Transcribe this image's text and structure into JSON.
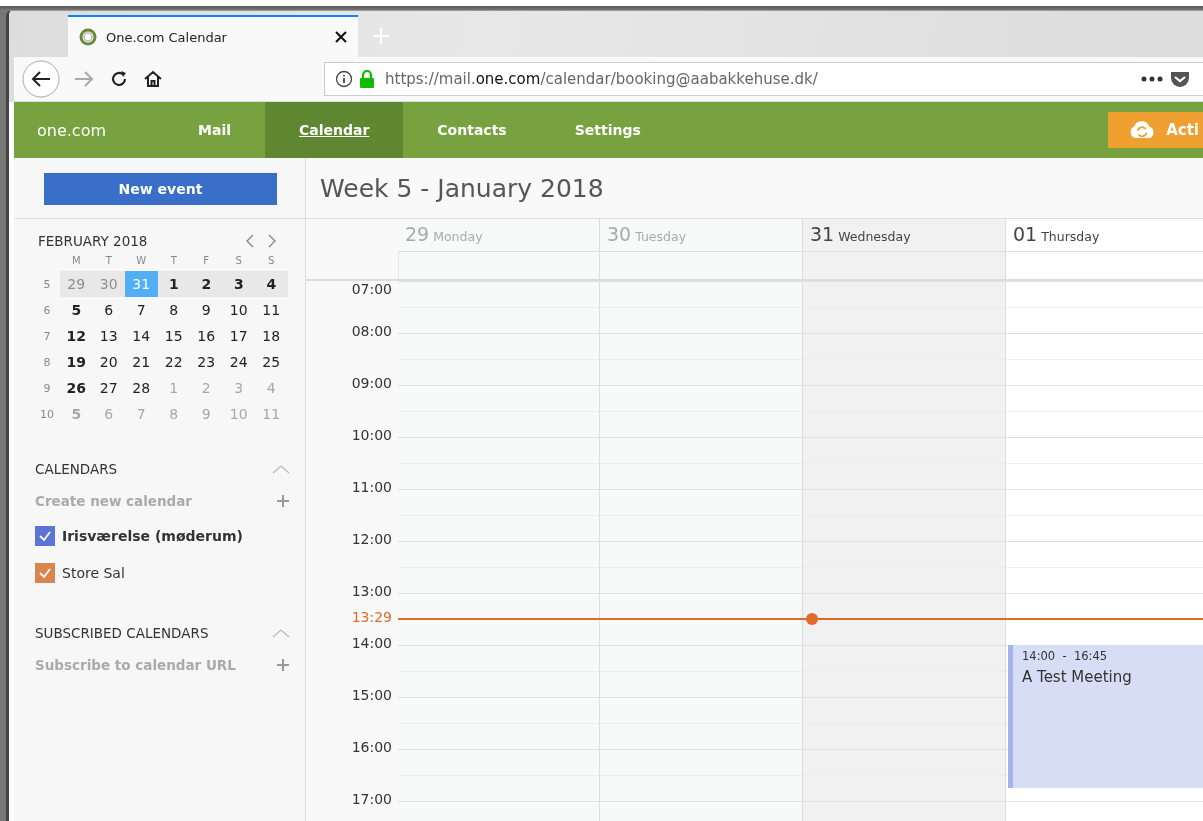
{
  "browser": {
    "tab_title": "One.com Calendar",
    "url": [
      {
        "text": "https://mail.",
        "emphasis": false
      },
      {
        "text": "one.com",
        "emphasis": true
      },
      {
        "text": "/calendar/booking@aabakkehuse.dk/",
        "emphasis": false
      }
    ],
    "forward_disabled": true
  },
  "app_bar": {
    "logo": "one.com",
    "items": [
      {
        "label": "Mail",
        "selected": false
      },
      {
        "label": "Calendar",
        "selected": true
      },
      {
        "label": "Contacts",
        "selected": false
      },
      {
        "label": "Settings",
        "selected": false
      }
    ],
    "action_button": "Acti"
  },
  "sidebar": {
    "new_event_button": "New event",
    "mini_calendar": {
      "title": "FEBRUARY 2018",
      "weekdays": [
        "M",
        "T",
        "W",
        "T",
        "F",
        "S",
        "S"
      ],
      "weeks": [
        {
          "number": "5",
          "current": true,
          "days": [
            {
              "label": "29",
              "kind": "other",
              "bold": false,
              "selected": false
            },
            {
              "label": "30",
              "kind": "other",
              "bold": false,
              "selected": false
            },
            {
              "label": "31",
              "kind": "month",
              "bold": false,
              "selected": true
            },
            {
              "label": "1",
              "kind": "month",
              "bold": true,
              "selected": false
            },
            {
              "label": "2",
              "kind": "month",
              "bold": true,
              "selected": false
            },
            {
              "label": "3",
              "kind": "month",
              "bold": true,
              "selected": false
            },
            {
              "label": "4",
              "kind": "month",
              "bold": true,
              "selected": false
            }
          ]
        },
        {
          "number": "6",
          "current": false,
          "days": [
            {
              "label": "5",
              "kind": "month",
              "bold": true,
              "selected": false
            },
            {
              "label": "6",
              "kind": "month",
              "bold": false,
              "selected": false
            },
            {
              "label": "7",
              "kind": "month",
              "bold": false,
              "selected": false
            },
            {
              "label": "8",
              "kind": "month",
              "bold": false,
              "selected": false
            },
            {
              "label": "9",
              "kind": "month",
              "bold": false,
              "selected": false
            },
            {
              "label": "10",
              "kind": "month",
              "bold": false,
              "selected": false
            },
            {
              "label": "11",
              "kind": "month",
              "bold": false,
              "selected": false
            }
          ]
        },
        {
          "number": "7",
          "current": false,
          "days": [
            {
              "label": "12",
              "kind": "month",
              "bold": true,
              "selected": false
            },
            {
              "label": "13",
              "kind": "month",
              "bold": false,
              "selected": false
            },
            {
              "label": "14",
              "kind": "month",
              "bold": false,
              "selected": false
            },
            {
              "label": "15",
              "kind": "month",
              "bold": false,
              "selected": false
            },
            {
              "label": "16",
              "kind": "month",
              "bold": false,
              "selected": false
            },
            {
              "label": "17",
              "kind": "month",
              "bold": false,
              "selected": false
            },
            {
              "label": "18",
              "kind": "month",
              "bold": false,
              "selected": false
            }
          ]
        },
        {
          "number": "8",
          "current": false,
          "days": [
            {
              "label": "19",
              "kind": "month",
              "bold": true,
              "selected": false
            },
            {
              "label": "20",
              "kind": "month",
              "bold": false,
              "selected": false
            },
            {
              "label": "21",
              "kind": "month",
              "bold": false,
              "selected": false
            },
            {
              "label": "22",
              "kind": "month",
              "bold": false,
              "selected": false
            },
            {
              "label": "23",
              "kind": "month",
              "bold": false,
              "selected": false
            },
            {
              "label": "24",
              "kind": "month",
              "bold": false,
              "selected": false
            },
            {
              "label": "25",
              "kind": "month",
              "bold": false,
              "selected": false
            }
          ]
        },
        {
          "number": "9",
          "current": false,
          "days": [
            {
              "label": "26",
              "kind": "month",
              "bold": true,
              "selected": false
            },
            {
              "label": "27",
              "kind": "month",
              "bold": false,
              "selected": false
            },
            {
              "label": "28",
              "kind": "month",
              "bold": false,
              "selected": false
            },
            {
              "label": "1",
              "kind": "other",
              "bold": false,
              "selected": false
            },
            {
              "label": "2",
              "kind": "other",
              "bold": false,
              "selected": false
            },
            {
              "label": "3",
              "kind": "other",
              "bold": false,
              "selected": false
            },
            {
              "label": "4",
              "kind": "other",
              "bold": false,
              "selected": false
            }
          ]
        },
        {
          "number": "10",
          "current": false,
          "days": [
            {
              "label": "5",
              "kind": "other",
              "bold": true,
              "selected": false
            },
            {
              "label": "6",
              "kind": "other",
              "bold": false,
              "selected": false
            },
            {
              "label": "7",
              "kind": "other",
              "bold": false,
              "selected": false
            },
            {
              "label": "8",
              "kind": "other",
              "bold": false,
              "selected": false
            },
            {
              "label": "9",
              "kind": "other",
              "bold": false,
              "selected": false
            },
            {
              "label": "10",
              "kind": "other",
              "bold": false,
              "selected": false
            },
            {
              "label": "11",
              "kind": "other",
              "bold": false,
              "selected": false
            }
          ]
        }
      ]
    },
    "sections": [
      {
        "title": "CALENDARS",
        "expanded": true,
        "action": "Create new calendar",
        "calendars": [
          {
            "name": "Irisværelse (møderum)",
            "checked": true,
            "color": "#5b74d6",
            "emphasized": true
          },
          {
            "name": "Store Sal",
            "checked": true,
            "color": "#d9864e",
            "emphasized": false
          }
        ]
      },
      {
        "title": "SUBSCRIBED CALENDARS",
        "expanded": true,
        "action": "Subscribe to calendar URL"
      }
    ]
  },
  "week": {
    "title": "Week 5 - January 2018",
    "days": [
      {
        "number": "29",
        "name": "Monday",
        "kind": "past"
      },
      {
        "number": "30",
        "name": "Tuesday",
        "kind": "past"
      },
      {
        "number": "31",
        "name": "Wednesday",
        "kind": "today"
      },
      {
        "number": "01",
        "name": "Thursday",
        "kind": "future",
        "events": [
          {
            "time": "14:00  -  16:45",
            "title": "A Test Meeting",
            "color": "#d6ddf5"
          }
        ]
      }
    ],
    "hours": [
      "07:00",
      "08:00",
      "09:00",
      "10:00",
      "11:00",
      "12:00",
      "13:00",
      "14:00",
      "15:00",
      "16:00",
      "17:00"
    ],
    "now": "13:29"
  }
}
